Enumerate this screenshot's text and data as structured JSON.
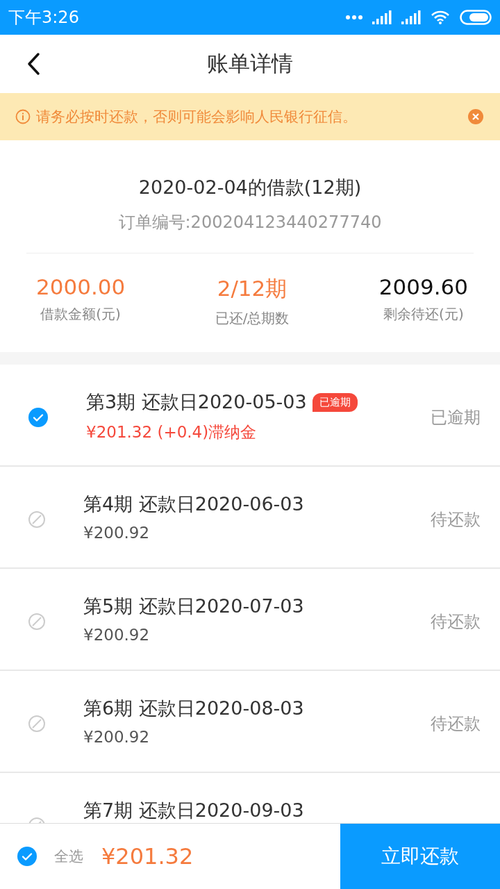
{
  "status_bar": {
    "time": "下午3:26"
  },
  "header": {
    "title": "账单详情"
  },
  "notice": {
    "text": "请务必按时还款，否则可能会影响人民银行征信。"
  },
  "loan": {
    "title": "2020-02-04的借款(12期)",
    "order_no": "订单编号:200204123440277740",
    "stats": [
      {
        "value": "2000.00",
        "label": "借款金额(元)",
        "highlight": true
      },
      {
        "value": "2/12期",
        "label": "已还/总期数",
        "highlight": true
      },
      {
        "value": "2009.60",
        "label": "剩余待还(元)",
        "highlight": false
      }
    ]
  },
  "installments": [
    {
      "title": "第3期 还款日2020-05-03",
      "badge": "已逾期",
      "amount": "¥201.32 (+0.4)滞纳金",
      "status": "已逾期",
      "selected": true,
      "disabled": false,
      "overdue": true
    },
    {
      "title": "第4期 还款日2020-06-03",
      "amount": "¥200.92",
      "status": "待还款",
      "selected": false,
      "disabled": true,
      "overdue": false
    },
    {
      "title": "第5期 还款日2020-07-03",
      "amount": "¥200.92",
      "status": "待还款",
      "selected": false,
      "disabled": true,
      "overdue": false
    },
    {
      "title": "第6期 还款日2020-08-03",
      "amount": "¥200.92",
      "status": "待还款",
      "selected": false,
      "disabled": true,
      "overdue": false
    },
    {
      "title": "第7期 还款日2020-09-03",
      "selected": false,
      "disabled": true,
      "overdue": false
    }
  ],
  "footer": {
    "select_all_label": "全选",
    "select_all_checked": true,
    "total": "¥201.32",
    "pay_button": "立即还款"
  }
}
